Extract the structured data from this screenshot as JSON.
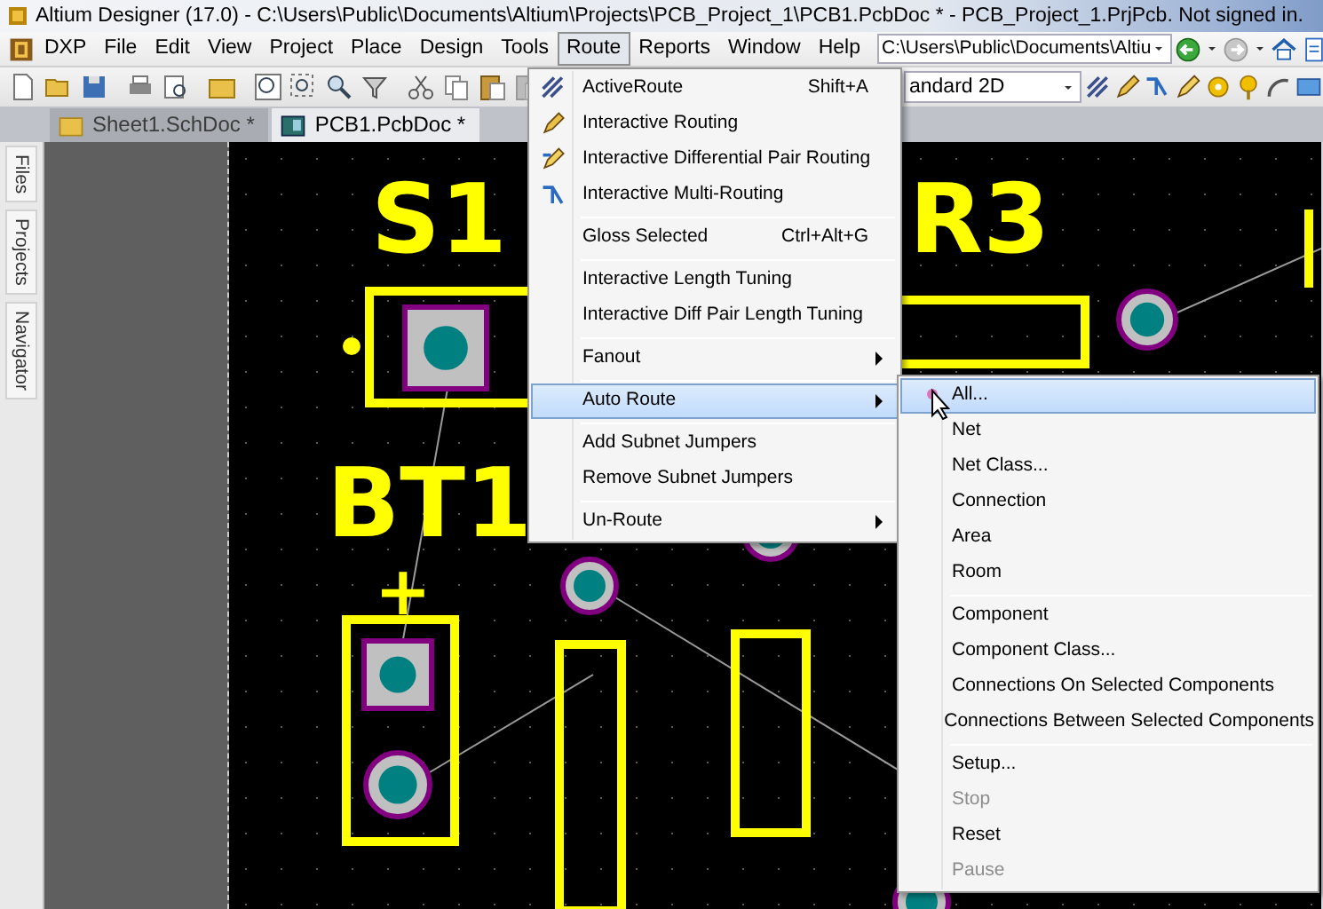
{
  "window": {
    "title": "Altium Designer (17.0) - C:\\Users\\Public\\Documents\\Altium\\Projects\\PCB_Project_1\\PCB1.PcbDoc * - PCB_Project_1.PrjPcb. Not signed in."
  },
  "menu_bar": {
    "items": [
      {
        "label": "DXP",
        "selected": false
      },
      {
        "label": "File",
        "selected": false
      },
      {
        "label": "Edit",
        "selected": false
      },
      {
        "label": "View",
        "selected": false
      },
      {
        "label": "Project",
        "selected": false
      },
      {
        "label": "Place",
        "selected": false
      },
      {
        "label": "Design",
        "selected": false
      },
      {
        "label": "Tools",
        "selected": false
      },
      {
        "label": "Route",
        "selected": true
      },
      {
        "label": "Reports",
        "selected": false
      },
      {
        "label": "Window",
        "selected": false
      },
      {
        "label": "Help",
        "selected": false
      }
    ],
    "path_field": {
      "value": "C:\\Users\\Public\\Documents\\Altiu"
    }
  },
  "toolbar": {
    "view_combo": {
      "value": "andard 2D"
    }
  },
  "doc_tabs": [
    {
      "label": "Sheet1.SchDoc *",
      "selected": false
    },
    {
      "label": "PCB1.PcbDoc *",
      "selected": true
    }
  ],
  "side_panel_tabs": [
    {
      "label": "Files"
    },
    {
      "label": "Projects"
    },
    {
      "label": "Navigator"
    }
  ],
  "canvas": {
    "labels": [
      {
        "text": "S1"
      },
      {
        "text": "R3"
      },
      {
        "text": "BT1"
      },
      {
        "text": "+"
      }
    ]
  },
  "route_menu": {
    "items": [
      {
        "kind": "item",
        "label": "ActiveRoute",
        "shortcut": "Shift+A",
        "submenu": false,
        "selected": false,
        "disabled": false
      },
      {
        "kind": "item",
        "label": "Interactive Routing",
        "submenu": false,
        "selected": false,
        "disabled": false
      },
      {
        "kind": "item",
        "label": "Interactive Differential Pair Routing",
        "submenu": false,
        "selected": false,
        "disabled": false
      },
      {
        "kind": "item",
        "label": "Interactive Multi-Routing",
        "submenu": false,
        "selected": false,
        "disabled": false
      },
      {
        "kind": "separator"
      },
      {
        "kind": "item",
        "label": "Gloss Selected",
        "shortcut": "Ctrl+Alt+G",
        "submenu": false,
        "selected": false,
        "disabled": false
      },
      {
        "kind": "separator"
      },
      {
        "kind": "item",
        "label": "Interactive Length Tuning",
        "submenu": false,
        "selected": false,
        "disabled": false
      },
      {
        "kind": "item",
        "label": "Interactive Diff Pair Length Tuning",
        "submenu": false,
        "selected": false,
        "disabled": false
      },
      {
        "kind": "separator"
      },
      {
        "kind": "item",
        "label": "Fanout",
        "submenu": true,
        "selected": false,
        "disabled": false
      },
      {
        "kind": "separator"
      },
      {
        "kind": "item",
        "label": "Auto Route",
        "submenu": true,
        "selected": true,
        "disabled": false
      },
      {
        "kind": "separator"
      },
      {
        "kind": "item",
        "label": "Add Subnet Jumpers",
        "submenu": false,
        "selected": false,
        "disabled": false
      },
      {
        "kind": "item",
        "label": "Remove Subnet Jumpers",
        "submenu": false,
        "selected": false,
        "disabled": false
      },
      {
        "kind": "separator"
      },
      {
        "kind": "item",
        "label": "Un-Route",
        "submenu": true,
        "selected": false,
        "disabled": false
      }
    ]
  },
  "auto_route_submenu": {
    "items": [
      {
        "kind": "item",
        "label": "All...",
        "selected": true,
        "disabled": false
      },
      {
        "kind": "item",
        "label": "Net",
        "selected": false,
        "disabled": false
      },
      {
        "kind": "item",
        "label": "Net Class...",
        "selected": false,
        "disabled": false
      },
      {
        "kind": "item",
        "label": "Connection",
        "selected": false,
        "disabled": false
      },
      {
        "kind": "item",
        "label": "Area",
        "selected": false,
        "disabled": false
      },
      {
        "kind": "item",
        "label": "Room",
        "selected": false,
        "disabled": false
      },
      {
        "kind": "separator"
      },
      {
        "kind": "item",
        "label": "Component",
        "selected": false,
        "disabled": false
      },
      {
        "kind": "item",
        "label": "Component Class...",
        "selected": false,
        "disabled": false
      },
      {
        "kind": "item",
        "label": "Connections On Selected Components",
        "selected": false,
        "disabled": false
      },
      {
        "kind": "item",
        "label": "Connections Between Selected Components",
        "selected": false,
        "disabled": false
      },
      {
        "kind": "separator"
      },
      {
        "kind": "item",
        "label": "Setup...",
        "selected": false,
        "disabled": false
      },
      {
        "kind": "item",
        "label": "Stop",
        "selected": false,
        "disabled": true
      },
      {
        "kind": "item",
        "label": "Reset",
        "selected": false,
        "disabled": false
      },
      {
        "kind": "item",
        "label": "Pause",
        "selected": false,
        "disabled": true
      }
    ]
  }
}
